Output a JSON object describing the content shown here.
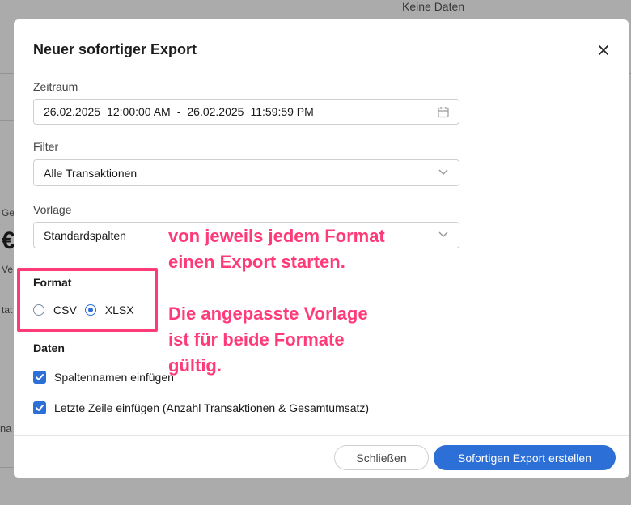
{
  "background": {
    "top_text": "Keine Daten",
    "side_fragment_1": "Ge",
    "side_fragment_2": "Ve",
    "side_fragment_3": "tat",
    "side_fragment_4": "na",
    "currency_glyph": "€"
  },
  "modal": {
    "title": "Neuer sofortiger Export",
    "close_icon": "close-icon",
    "zeitraum": {
      "label": "Zeitraum",
      "start_date": "26.02.2025",
      "start_time": "12:00:00 AM",
      "separator": "-",
      "end_date": "26.02.2025",
      "end_time": "11:59:59 PM",
      "icon": "calendar-icon"
    },
    "filter": {
      "label": "Filter",
      "value": "Alle Transaktionen"
    },
    "vorlage": {
      "label": "Vorlage",
      "value": "Standardspalten"
    },
    "format": {
      "label": "Format",
      "options": [
        {
          "label": "CSV",
          "checked": false
        },
        {
          "label": "XLSX",
          "checked": true
        }
      ]
    },
    "daten": {
      "label": "Daten",
      "options": [
        {
          "label": "Spaltennamen einfügen",
          "checked": true
        },
        {
          "label": "Letzte Zeile einfügen (Anzahl Transaktionen & Gesamtumsatz)",
          "checked": true
        }
      ]
    },
    "footer": {
      "close_label": "Schließen",
      "submit_label": "Sofortigen Export erstellen"
    }
  },
  "annotation": {
    "lines": [
      "von jeweils jedem Format",
      "einen Export starten.",
      "",
      "Die angepasste Vorlage",
      "ist für beide Formate",
      "gültig."
    ]
  },
  "colors": {
    "accent": "#2c6fd6",
    "annotation": "#ff3a78",
    "overlay": "#4a4a4a"
  }
}
